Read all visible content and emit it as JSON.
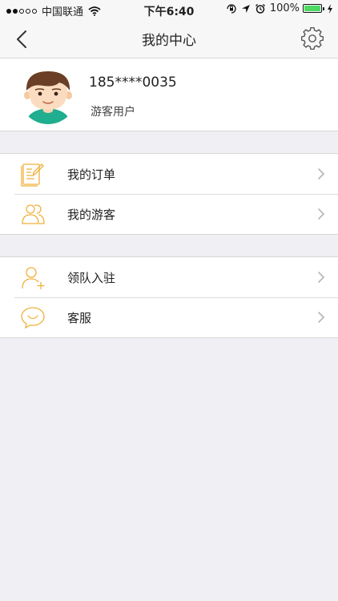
{
  "status_bar": {
    "carrier": "中国联通",
    "time": "下午6:40",
    "battery_text": "100%",
    "battery_level": 1.0,
    "battery_color": "#4cd964",
    "icons": [
      "signal-dots-icon",
      "wifi-icon",
      "orientation-lock-icon",
      "location-arrow-icon",
      "alarm-icon",
      "battery-icon",
      "charging-bolt-icon"
    ]
  },
  "nav": {
    "title": "我的中心",
    "back_icon": "back-chevron-icon",
    "settings_icon": "gear-icon"
  },
  "profile": {
    "phone": "185****0035",
    "role": "游客用户",
    "avatar_icon": "user-avatar-icon"
  },
  "menu_group_1": [
    {
      "label": "我的订单",
      "icon": "order-icon"
    },
    {
      "label": "我的游客",
      "icon": "tourists-icon"
    }
  ],
  "menu_group_2": [
    {
      "label": "领队入驻",
      "icon": "add-leader-icon"
    },
    {
      "label": "客服",
      "icon": "customer-service-icon"
    }
  ],
  "colors": {
    "accent": "#f0b13c",
    "background": "#efeff4",
    "divider": "#d8d8d8"
  }
}
